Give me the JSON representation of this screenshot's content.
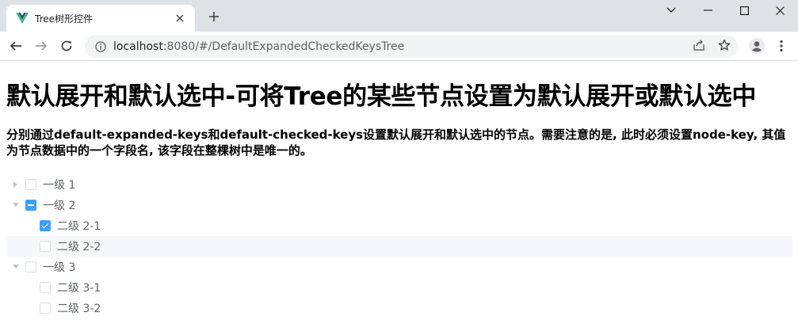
{
  "browser": {
    "tab_title": "Tree树形控件",
    "url_host": "localhost",
    "url_rest": ":8080/#/DefaultExpandedCheckedKeysTree"
  },
  "page": {
    "title": "默认展开和默认选中-可将Tree的某些节点设置为默认展开或默认选中",
    "description": "分别通过default-expanded-keys和default-checked-keys设置默认展开和默认选中的节点。需要注意的是, 此时必须设置node-key, 其值为节点数据中的一个字段名, 该字段在整棵树中是唯一的。"
  },
  "tree": {
    "nodes": [
      {
        "label": "一级 1",
        "level": 1,
        "expanded": false,
        "check": "unchecked",
        "leaf": false
      },
      {
        "label": "一级 2",
        "level": 1,
        "expanded": true,
        "check": "indeterminate",
        "leaf": false
      },
      {
        "label": "二级 2-1",
        "level": 2,
        "check": "checked",
        "leaf": true
      },
      {
        "label": "二级 2-2",
        "level": 2,
        "check": "unchecked",
        "leaf": true,
        "hover": true
      },
      {
        "label": "一级 3",
        "level": 1,
        "expanded": true,
        "check": "unchecked",
        "leaf": false
      },
      {
        "label": "二级 3-1",
        "level": 2,
        "check": "unchecked",
        "leaf": true
      },
      {
        "label": "二级 3-2",
        "level": 2,
        "check": "unchecked",
        "leaf": true
      }
    ]
  },
  "colors": {
    "checked": "#409eff",
    "tree_text": "#606266",
    "hover_row": "#f5f7fa",
    "vue_green": "#42b883",
    "vue_dark": "#35495e"
  }
}
